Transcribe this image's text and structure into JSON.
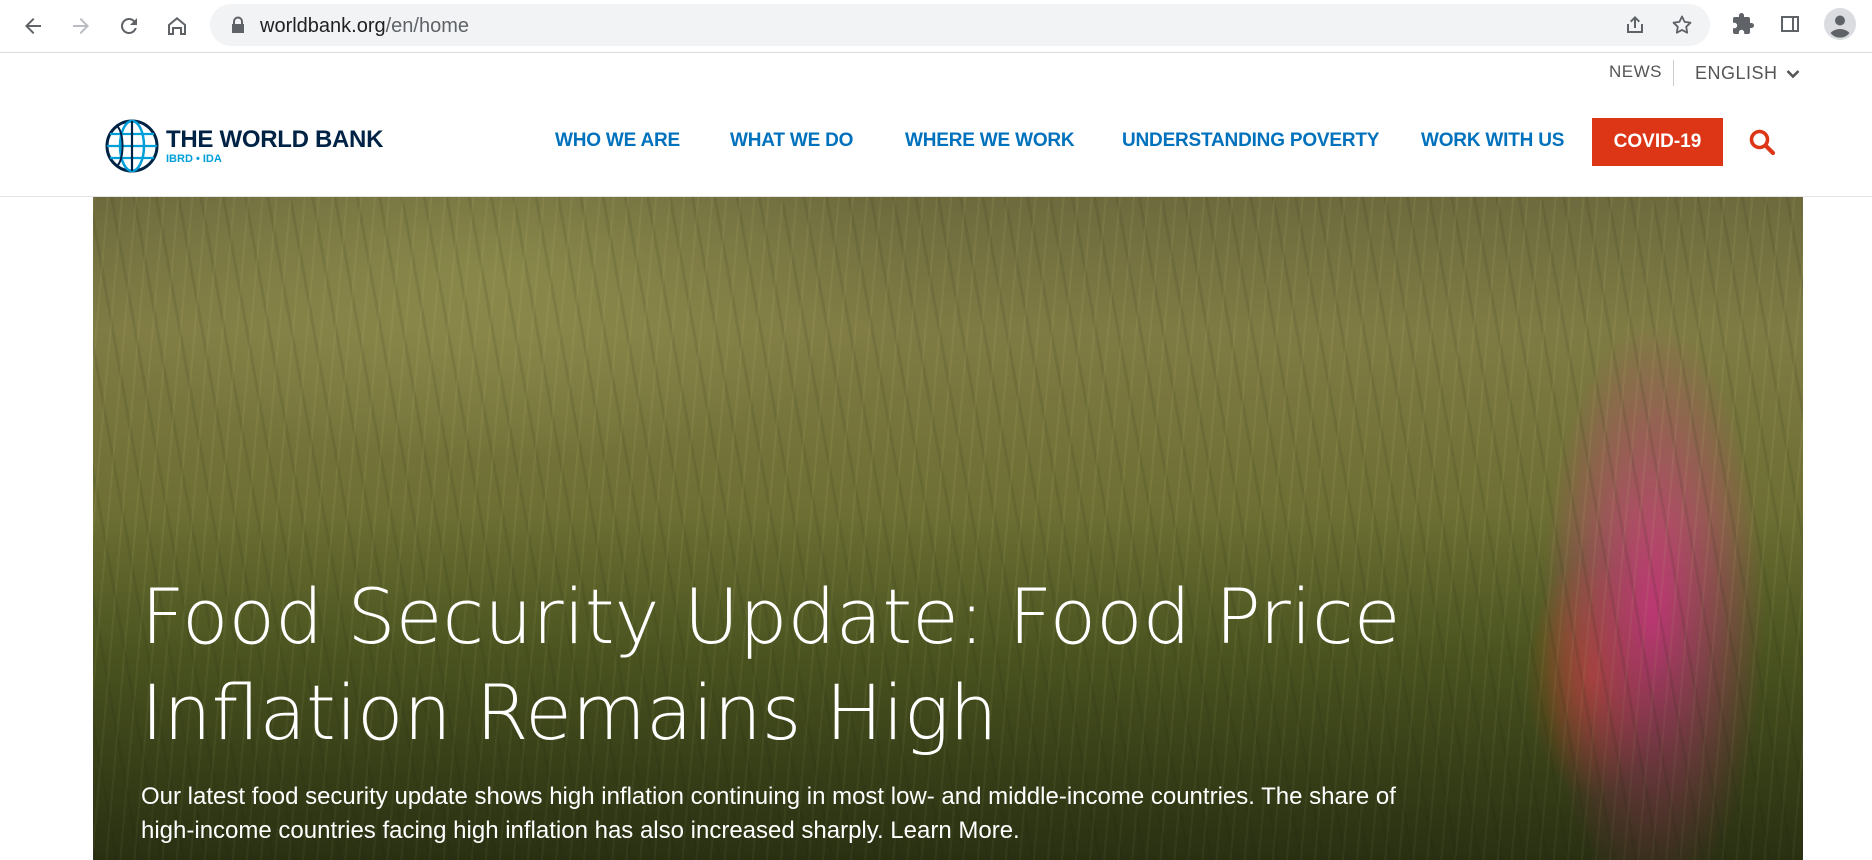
{
  "browser": {
    "url_domain": "worldbank.org",
    "url_path": "/en/home"
  },
  "utility": {
    "news": "NEWS",
    "language": "ENGLISH"
  },
  "logo": {
    "title": "THE WORLD BANK",
    "subtitle": "IBRD • IDA"
  },
  "menu": [
    {
      "label": "WHO WE ARE"
    },
    {
      "label": "WHAT WE DO"
    },
    {
      "label": "WHERE WE WORK"
    },
    {
      "label": "UNDERSTANDING POVERTY"
    },
    {
      "label": "WORK WITH US"
    }
  ],
  "covid_label": "COVID-19",
  "colors": {
    "brand_blue": "#0071bc",
    "navy": "#002244",
    "covid_red": "#dc3617"
  },
  "hero": {
    "title_line1": "Food Security Update: Food Price",
    "title_line2": "Inflation Remains High",
    "description_line1": "Our latest food security update shows high inflation continuing in most low- and middle-income countries. The share of",
    "description_line2": "high-income countries facing high inflation has also increased sharply. Learn More."
  }
}
